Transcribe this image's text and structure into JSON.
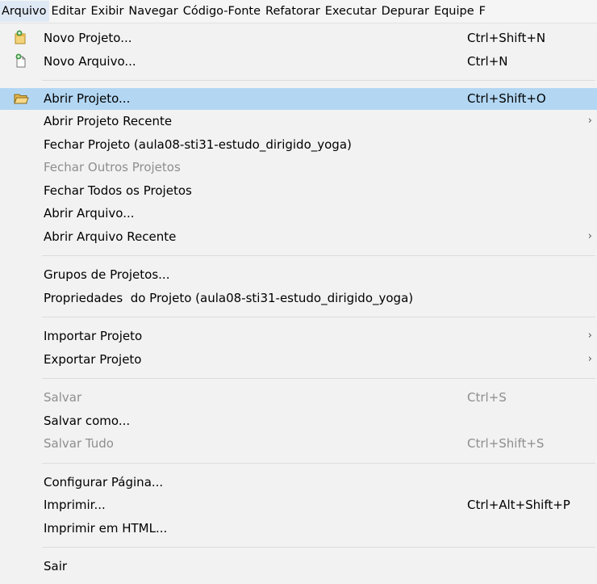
{
  "menubar": {
    "items": [
      "Arquivo",
      "Editar",
      "Exibir",
      "Navegar",
      "Código-Fonte",
      "Refatorar",
      "Executar",
      "Depurar",
      "Equipe",
      "F"
    ]
  },
  "file_menu": {
    "new_project": {
      "label": "Novo Projeto...",
      "accel": "Ctrl+Shift+N",
      "icon": "new-project-icon"
    },
    "new_file": {
      "label": "Novo Arquivo...",
      "accel": "Ctrl+N",
      "icon": "new-file-icon"
    },
    "open_project": {
      "label": "Abrir Projeto...",
      "accel": "Ctrl+Shift+O",
      "icon": "open-folder-icon"
    },
    "open_recent_project": {
      "label": "Abrir Projeto Recente"
    },
    "close_project": {
      "label": "Fechar Projeto (aula08-sti31-estudo_dirigido_yoga)"
    },
    "close_other_projects": {
      "label": "Fechar Outros Projetos"
    },
    "close_all_projects": {
      "label": "Fechar Todos os Projetos"
    },
    "open_file": {
      "label": "Abrir Arquivo..."
    },
    "open_recent_file": {
      "label": "Abrir Arquivo Recente"
    },
    "project_groups": {
      "label": "Grupos de Projetos..."
    },
    "project_properties": {
      "label": "Propriedades  do Projeto (aula08-sti31-estudo_dirigido_yoga)"
    },
    "import_project": {
      "label": "Importar Projeto"
    },
    "export_project": {
      "label": "Exportar Projeto"
    },
    "save": {
      "label": "Salvar",
      "accel": "Ctrl+S"
    },
    "save_as": {
      "label": "Salvar como..."
    },
    "save_all": {
      "label": "Salvar Tudo",
      "accel": "Ctrl+Shift+S"
    },
    "page_setup": {
      "label": "Configurar Página..."
    },
    "print": {
      "label": "Imprimir...",
      "accel": "Ctrl+Alt+Shift+P"
    },
    "print_html": {
      "label": "Imprimir em HTML..."
    },
    "exit": {
      "label": "Sair"
    }
  },
  "submenu_arrow": "›"
}
